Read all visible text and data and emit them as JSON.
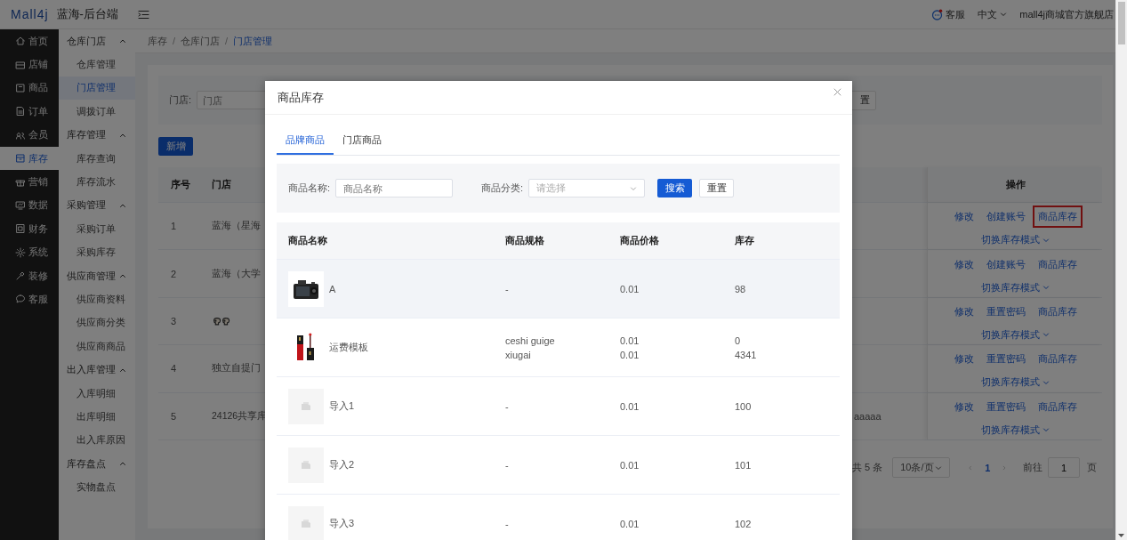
{
  "header": {
    "logo": "Mall4j",
    "title": "蓝海-后台端",
    "service": "客服",
    "language": "中文",
    "shop": "mall4j商城官方旗舰店"
  },
  "sidebar": {
    "items": [
      {
        "label": "首页",
        "selected": false
      },
      {
        "label": "店铺",
        "selected": false
      },
      {
        "label": "商品",
        "selected": false
      },
      {
        "label": "订单",
        "selected": false
      },
      {
        "label": "会员",
        "selected": false
      },
      {
        "label": "库存",
        "selected": true
      },
      {
        "label": "营销",
        "selected": false
      },
      {
        "label": "数据",
        "selected": false
      },
      {
        "label": "财务",
        "selected": false
      },
      {
        "label": "系统",
        "selected": false
      },
      {
        "label": "装修",
        "selected": false
      },
      {
        "label": "客服",
        "selected": false
      }
    ]
  },
  "submenu": {
    "groups": [
      {
        "label": "仓库门店",
        "expanded": true,
        "children": [
          {
            "label": "仓库管理",
            "selected": false
          },
          {
            "label": "门店管理",
            "selected": true
          },
          {
            "label": "调拨订单",
            "selected": false
          }
        ]
      },
      {
        "label": "库存管理",
        "expanded": true,
        "children": [
          {
            "label": "库存查询",
            "selected": false
          },
          {
            "label": "库存流水",
            "selected": false
          }
        ]
      },
      {
        "label": "采购管理",
        "expanded": true,
        "children": [
          {
            "label": "采购订单",
            "selected": false
          },
          {
            "label": "采购库存",
            "selected": false
          }
        ]
      },
      {
        "label": "供应商管理",
        "expanded": true,
        "children": [
          {
            "label": "供应商资料",
            "selected": false
          },
          {
            "label": "供应商分类",
            "selected": false
          },
          {
            "label": "供应商商品",
            "selected": false
          }
        ]
      },
      {
        "label": "出入库管理",
        "expanded": true,
        "children": [
          {
            "label": "入库明细",
            "selected": false
          },
          {
            "label": "出库明细",
            "selected": false
          },
          {
            "label": "出入库原因",
            "selected": false
          }
        ]
      },
      {
        "label": "库存盘点",
        "expanded": true,
        "children": [
          {
            "label": "实物盘点",
            "selected": false
          }
        ]
      }
    ]
  },
  "breadcrumb": {
    "separator": "/",
    "items": [
      {
        "label": "库存",
        "current": false
      },
      {
        "label": "仓库门店",
        "current": false
      },
      {
        "label": "门店管理",
        "current": true
      }
    ]
  },
  "filter": {
    "label": "门店:",
    "placeholder": "门店",
    "button_2": "置"
  },
  "add_button": "新增",
  "store_table": {
    "columns": [
      "序号",
      "门店",
      "操作"
    ],
    "rows": [
      {
        "index": "1",
        "store": {
          "kind": "text",
          "text": "蓝海（星海"
        },
        "actions": [
          {
            "label": "修改",
            "highlighted": false
          },
          {
            "label": "创建账号",
            "highlighted": false
          },
          {
            "label": "商品库存",
            "highlighted": true
          }
        ],
        "mode_menu": "切换库存模式"
      },
      {
        "index": "2",
        "store": {
          "kind": "text",
          "text": "蓝海（大学"
        },
        "actions": [
          {
            "label": "修改",
            "highlighted": false
          },
          {
            "label": "创建账号",
            "highlighted": false
          },
          {
            "label": "商品库存",
            "highlighted": false
          }
        ],
        "mode_menu": "切换库存模式"
      },
      {
        "index": "3",
        "store": {
          "kind": "icons"
        },
        "actions": [
          {
            "label": "修改",
            "highlighted": false
          },
          {
            "label": "重置密码",
            "highlighted": false
          },
          {
            "label": "商品库存",
            "highlighted": false
          }
        ],
        "mode_menu": "切换库存模式"
      },
      {
        "index": "4",
        "store": {
          "kind": "text",
          "text": "独立自提门"
        },
        "actions": [
          {
            "label": "修改",
            "highlighted": false
          },
          {
            "label": "重置密码",
            "highlighted": false
          },
          {
            "label": "商品库存",
            "highlighted": false
          }
        ],
        "mode_menu": "切换库存模式"
      },
      {
        "index": "5",
        "store": {
          "kind": "text",
          "text": "24126共享库"
        },
        "column_3": "aaaaa",
        "actions": [
          {
            "label": "修改",
            "highlighted": false
          },
          {
            "label": "重置密码",
            "highlighted": false
          },
          {
            "label": "商品库存",
            "highlighted": false
          }
        ],
        "mode_menu": "切换库存模式"
      }
    ]
  },
  "pagination": {
    "total": "共 5 条",
    "page_size": "10条/页",
    "pages": [
      {
        "label": "1",
        "selected": true
      }
    ],
    "goto_label": "前往",
    "goto_value": "1",
    "goto_suffix": "页"
  },
  "modal": {
    "title": "商品库存",
    "tabs": [
      {
        "label": "品牌商品",
        "selected": true
      },
      {
        "label": "门店商品",
        "selected": false
      }
    ],
    "search": {
      "name_label": "商品名称:",
      "name_placeholder": "商品名称",
      "category_label": "商品分类:",
      "category_placeholder": "请选择",
      "search_button": "搜索",
      "reset_button": "重置"
    },
    "columns": [
      "商品名称",
      "商品规格",
      "商品价格",
      "库存"
    ],
    "rows": [
      {
        "image": {
          "kind": "picture"
        },
        "name": "A",
        "specs": [
          "-"
        ],
        "prices": [
          "0.01"
        ],
        "stocks": [
          "98"
        ],
        "highlighted": true
      },
      {
        "image": {
          "kind": "picture"
        },
        "name": "运费模板",
        "specs": [
          "ceshi guige",
          "xiugai"
        ],
        "prices": [
          "0.01",
          "0.01"
        ],
        "stocks": [
          "0",
          "4341"
        ],
        "highlighted": false
      },
      {
        "image": {
          "kind": "placeholder"
        },
        "name": "导入1",
        "specs": [
          "-"
        ],
        "prices": [
          "0.01"
        ],
        "stocks": [
          "100"
        ],
        "highlighted": false
      },
      {
        "image": {
          "kind": "placeholder"
        },
        "name": "导入2",
        "specs": [
          "-"
        ],
        "prices": [
          "0.01"
        ],
        "stocks": [
          "101"
        ],
        "highlighted": false
      },
      {
        "image": {
          "kind": "placeholder"
        },
        "name": "导入3",
        "specs": [
          "-"
        ],
        "prices": [
          "0.01"
        ],
        "stocks": [
          "102"
        ],
        "highlighted": false
      }
    ]
  }
}
